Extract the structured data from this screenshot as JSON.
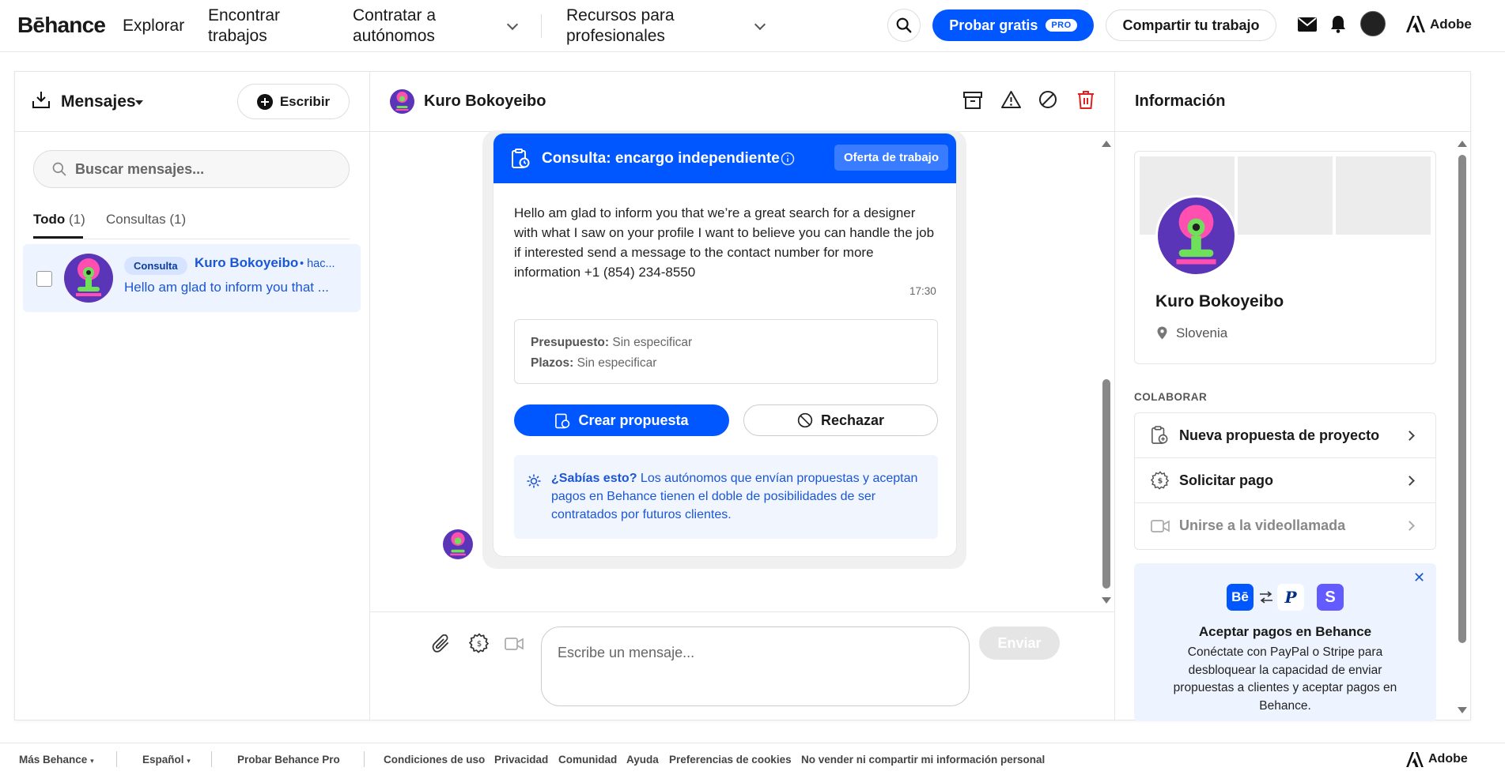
{
  "nav": {
    "logo": "Bēhance",
    "explorar": "Explorar",
    "encontrar_l1": "Encontrar",
    "encontrar_l2": "trabajos",
    "contratar_l1": "Contratar a",
    "contratar_l2": "autónomos",
    "recursos_l1": "Recursos para",
    "recursos_l2": "profesionales",
    "probar": "Probar gratis",
    "pro_badge": "PRO",
    "compartir": "Compartir tu trabajo",
    "adobe": "Adobe"
  },
  "inbox": {
    "title": "Mensajes",
    "write": "Escribir",
    "search_placeholder": "Buscar mensajes...",
    "tab_all": "Todo",
    "tab_all_count": "(1)",
    "tab_inquiries": "Consultas",
    "tab_inquiries_count": "(1)",
    "conversation": {
      "badge": "Consulta",
      "name": "Kuro Bokoyeibo",
      "time": "• hac...",
      "preview": "Hello am glad to inform you that ..."
    }
  },
  "thread": {
    "name": "Kuro Bokoyeibo",
    "card": {
      "title": "Consulta: encargo independiente",
      "offer": "Oferta de trabajo",
      "message": "Hello am glad to inform you that we’re a great search for a designer with what I saw on your profile I want to believe you can handle the job if interested send a message to the contact number for more information +1 (854) 234-8550",
      "time": "17:30",
      "budget_label": "Presupuesto:",
      "budget_value": "Sin especificar",
      "deadline_label": "Plazos:",
      "deadline_value": "Sin especificar",
      "create": "Crear propuesta",
      "reject": "Rechazar",
      "tip_bold": "¿Sabías esto?",
      "tip_text": " Los autónomos que envían propuestas y aceptan pagos en Behance tienen el doble de posibilidades de ser contratados por futuros clientes."
    },
    "composer_placeholder": "Escribe un mensaje...",
    "send": "Enviar"
  },
  "info": {
    "title": "Información",
    "name": "Kuro Bokoyeibo",
    "location": "Slovenia",
    "collab_label": "COLABORAR",
    "items": [
      {
        "label": "Nueva propuesta de proyecto"
      },
      {
        "label": "Solicitar pago"
      },
      {
        "label": "Unirse a la videollamada"
      }
    ],
    "promo_title": "Aceptar pagos en Behance",
    "promo_text": "Conéctate con PayPal o Stripe para desbloquear la capacidad de enviar propuestas a clientes y aceptar pagos en Behance."
  },
  "footer": {
    "mas": "Más Behance",
    "idioma": "Español",
    "pro": "Probar Behance Pro",
    "terminos": "Condiciones de uso",
    "privacidad": "Privacidad",
    "comunidad": "Comunidad",
    "ayuda": "Ayuda",
    "cookies": "Preferencias de cookies",
    "no_vender": "No vender ni compartir mi información personal",
    "adobe": "Adobe"
  },
  "colors": {
    "brand_blue": "#0057ff",
    "avatar_purple": "#5a35b8",
    "delete_red": "#e02020"
  }
}
